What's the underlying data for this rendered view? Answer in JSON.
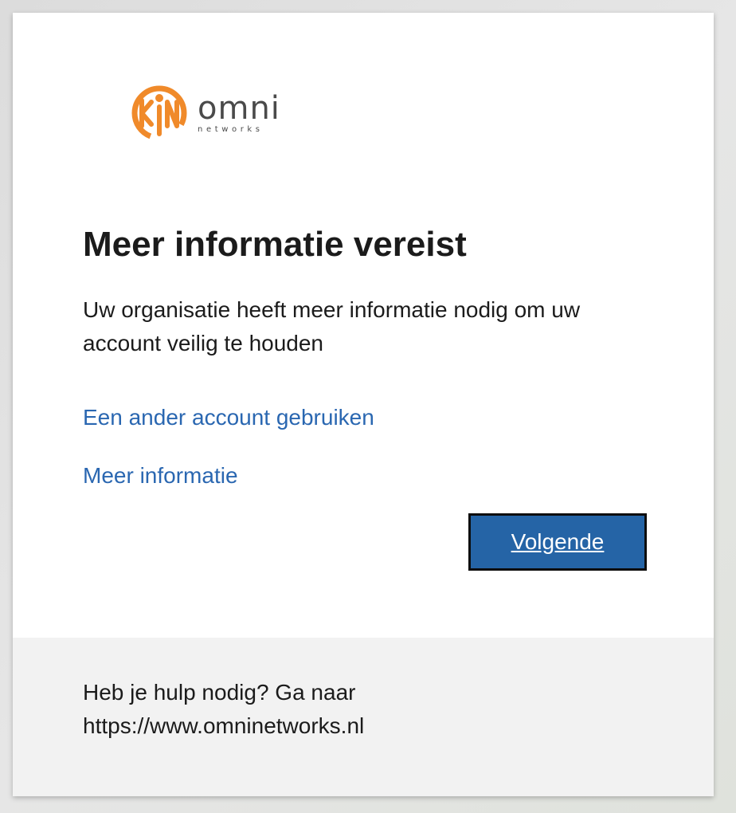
{
  "logo": {
    "icon": "omni-networks-logo-icon",
    "name": "omni",
    "sub": "networks",
    "accent_color": "#f08a2a",
    "text_color": "#4a4a4a"
  },
  "heading": "Meer informatie vereist",
  "description": "Uw organisatie heeft meer informatie nodig om uw account veilig te houden",
  "links": {
    "other_account": "Een ander account gebruiken",
    "more_info": "Meer informatie"
  },
  "buttons": {
    "next": "Volgende"
  },
  "footer": {
    "help_line1": "Heb je hulp nodig? Ga naar",
    "help_line2": "https://www.omninetworks.nl"
  },
  "colors": {
    "link": "#2a67b1",
    "primary_button": "#2564a6",
    "footer_bg": "#f2f2f2"
  }
}
